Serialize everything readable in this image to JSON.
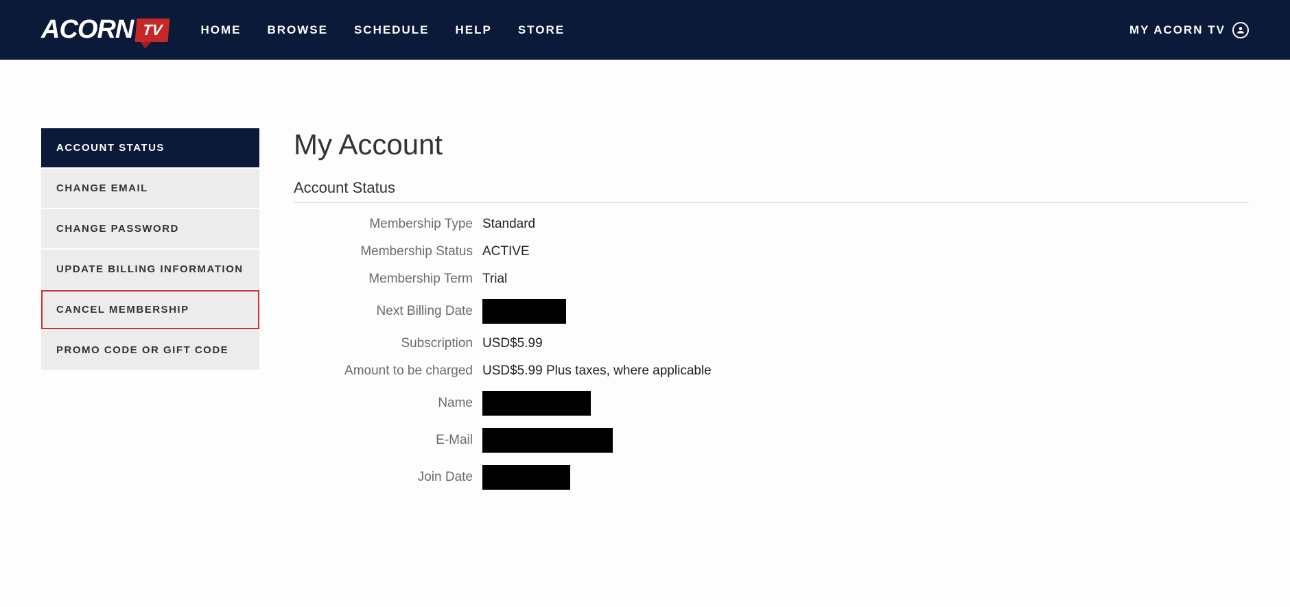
{
  "header": {
    "logo_main": "ACORN",
    "logo_tv": "TV",
    "nav": [
      {
        "label": "HOME"
      },
      {
        "label": "BROWSE"
      },
      {
        "label": "SCHEDULE"
      },
      {
        "label": "HELP"
      },
      {
        "label": "STORE"
      }
    ],
    "account_label": "MY ACORN TV"
  },
  "sidebar": {
    "items": [
      {
        "label": "ACCOUNT STATUS",
        "active": true
      },
      {
        "label": "CHANGE EMAIL"
      },
      {
        "label": "CHANGE PASSWORD"
      },
      {
        "label": "UPDATE BILLING INFORMATION"
      },
      {
        "label": "CANCEL MEMBERSHIP",
        "highlighted": true
      },
      {
        "label": "PROMO CODE OR GIFT CODE"
      }
    ]
  },
  "main": {
    "title": "My Account",
    "section": "Account Status",
    "fields": [
      {
        "label": "Membership Type",
        "value": "Standard"
      },
      {
        "label": "Membership Status",
        "value": "ACTIVE"
      },
      {
        "label": "Membership Term",
        "value": "Trial"
      },
      {
        "label": "Next Billing Date",
        "redacted": "w1"
      },
      {
        "label": "Subscription",
        "value": "USD$5.99"
      },
      {
        "label": "Amount to be charged",
        "value": "USD$5.99 Plus taxes, where applicable"
      },
      {
        "label": "Name",
        "redacted": "w2"
      },
      {
        "label": "E-Mail",
        "redacted": "w3"
      },
      {
        "label": "Join Date",
        "redacted": "w4"
      }
    ]
  }
}
